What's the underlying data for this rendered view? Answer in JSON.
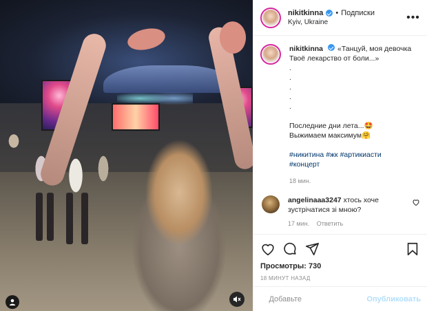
{
  "header": {
    "username": "nikitkinna",
    "separator": "•",
    "follow_label": "Подписки",
    "location": "Kyiv, Ukraine"
  },
  "caption": {
    "username": "nikitkinna",
    "lines": [
      "«Танцуй, моя девочка",
      "Твоё лекарство от боли...»",
      ".",
      ".",
      ".",
      ".",
      ".",
      "",
      "Последние дни лета...🤩",
      "Выжимаем максимум🤗",
      ""
    ],
    "hashtags_line1": "#никитина #жк #артикиасти",
    "hashtags_line2": "#концерт",
    "time_ago": "18 мин."
  },
  "comment": {
    "username": "angelinaaa3247",
    "text": "хтось хоче зустрічатися зі мною?",
    "time_ago": "17 мин.",
    "reply_label": "Ответить"
  },
  "actions": {
    "views_text": "Просмотры: 730",
    "date_text": "18 минут назад"
  },
  "add_comment": {
    "placeholder": "Добавьте",
    "publish_label": "Опубликовать"
  },
  "icons": {
    "like": "heart-icon",
    "comment": "comment-bubble-icon",
    "share": "paper-plane-icon",
    "save": "bookmark-icon",
    "emoji": "smiley-icon",
    "tagged": "user-tag-icon",
    "mute": "speaker-muted-icon",
    "more": "ellipsis-icon"
  },
  "colors": {
    "verified_badge": "#3897f0",
    "hashtag": "#00376b",
    "publish_disabled": "#b2dffc",
    "muted_text": "#8e8e8e"
  }
}
